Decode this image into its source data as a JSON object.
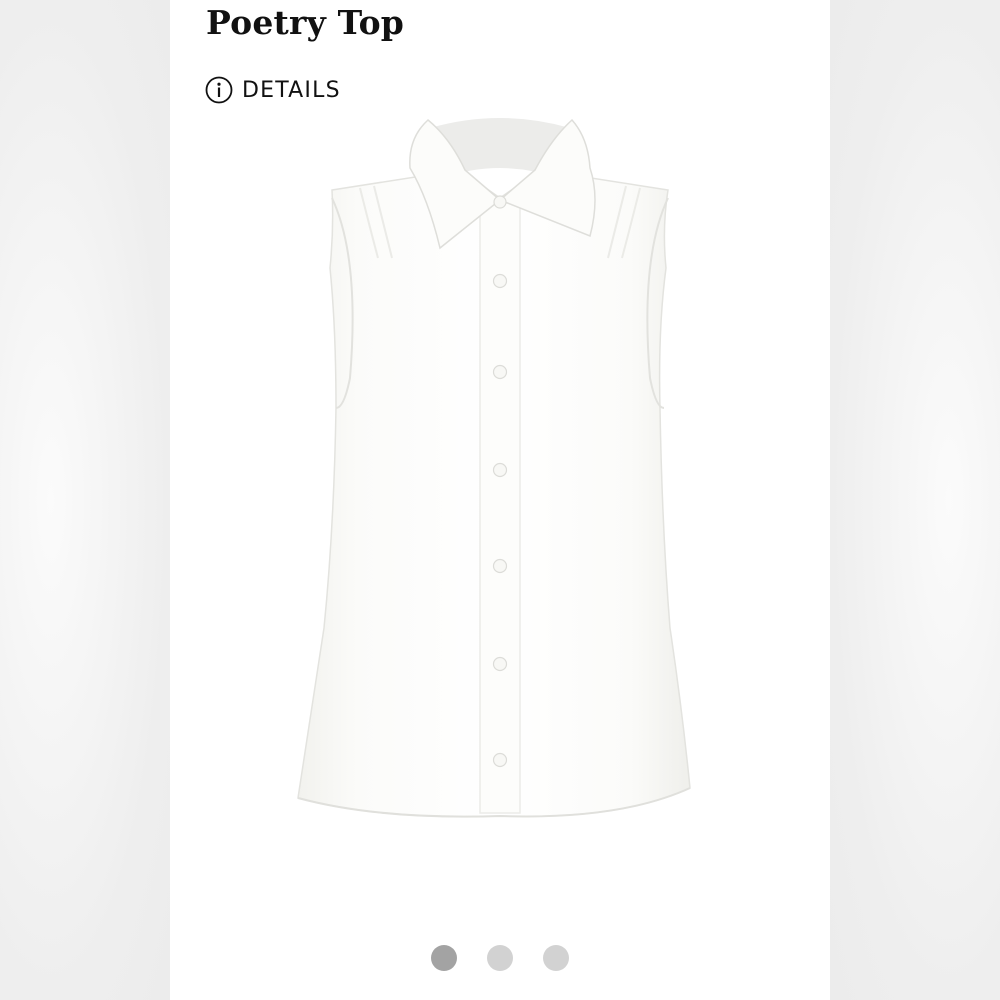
{
  "product": {
    "title": "Poetry Top",
    "details_label": "DETAILS",
    "image_icon": "sleeveless-button-up-blouse",
    "colors": {
      "text": "#111111",
      "blouse": "#fbfbf8",
      "dot_active": "#a3a3a3",
      "dot_inactive": "#d2d2d2"
    }
  },
  "carousel": {
    "total": 3,
    "active_index": 0
  }
}
